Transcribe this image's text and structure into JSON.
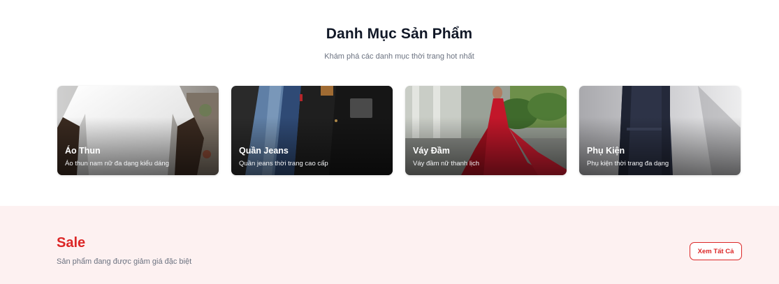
{
  "categories": {
    "title": "Danh Mục Sản Phẩm",
    "subtitle": "Khám phá các danh mục thời trang hot nhất",
    "items": [
      {
        "name": "Áo Thun",
        "description": "Áo thun nam nữ đa dạng kiểu dáng",
        "image": "white-tshirt-photo"
      },
      {
        "name": "Quần Jeans",
        "description": "Quần jeans thời trang cao cấp",
        "image": "stacked-jeans-photo"
      },
      {
        "name": "Váy Đầm",
        "description": "Váy đầm nữ thanh lịch",
        "image": "red-dress-photo"
      },
      {
        "name": "Phụ Kiện",
        "description": "Phụ kiện thời trang đa dạng",
        "image": "backpack-photo"
      }
    ]
  },
  "sale": {
    "title": "Sale",
    "subtitle": "Sản phẩm đang được giảm giá đặc biệt",
    "view_all_label": "Xem Tất Cả"
  },
  "colors": {
    "accent": "#dc2626",
    "sale_background": "#fdf1f1"
  }
}
